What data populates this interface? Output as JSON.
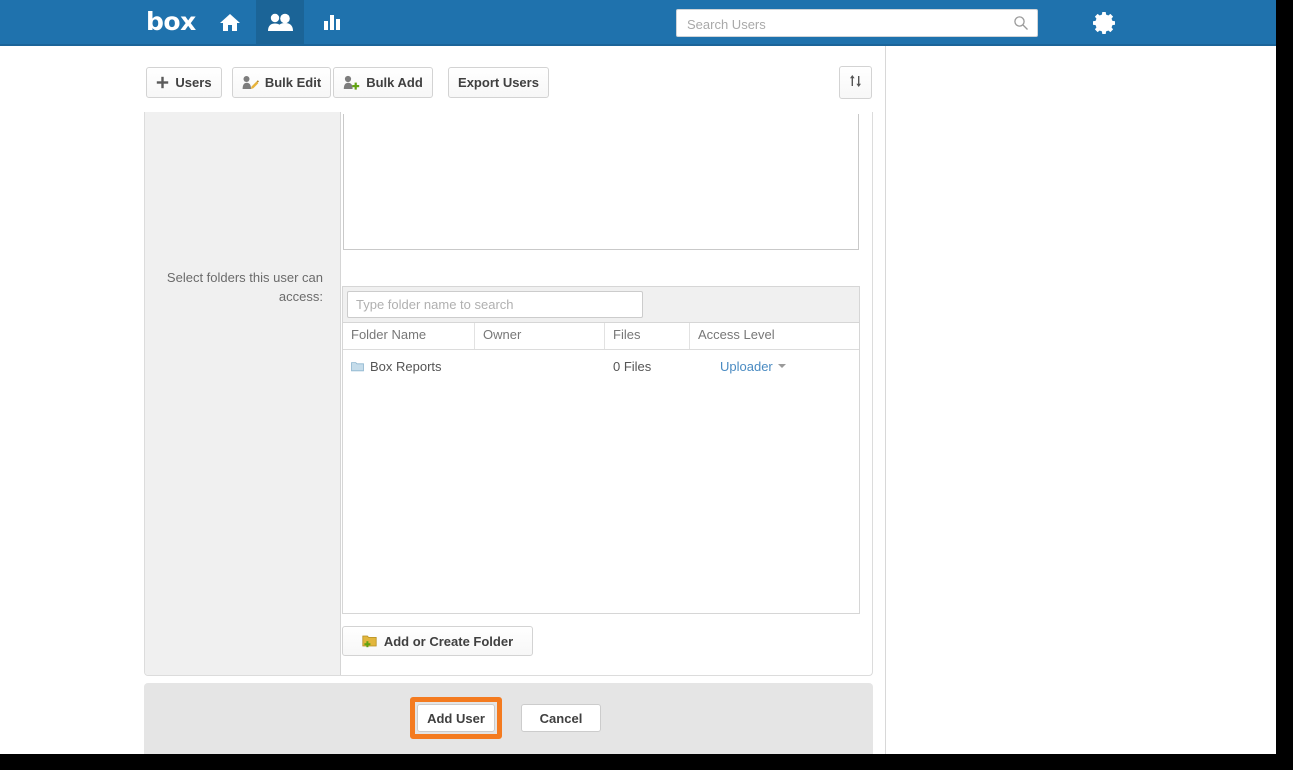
{
  "header": {
    "brand": "box",
    "nav": [
      {
        "name": "home-icon",
        "label": "Home",
        "active": false
      },
      {
        "name": "users-icon",
        "label": "Users",
        "active": true
      },
      {
        "name": "reports-icon",
        "label": "Reports",
        "active": false
      }
    ],
    "search": {
      "placeholder": "Search Users",
      "value": "",
      "icon": "search-icon"
    },
    "settings_icon": "gear-icon",
    "background_color": "#1f72ad"
  },
  "toolbar": {
    "users_label": "Users",
    "bulk_edit_label": "Bulk Edit",
    "bulk_add_label": "Bulk Add",
    "export_users_label": "Export Users",
    "sort_icon": "sort-arrows-icon"
  },
  "form": {
    "access_label": "Select folders this user can access:",
    "folder_search": {
      "placeholder": "Type folder name to search",
      "value": ""
    },
    "table": {
      "columns": [
        "Folder Name",
        "Owner",
        "Files",
        "Access Level"
      ],
      "rows": [
        {
          "folder_name": "Box Reports",
          "owner": "",
          "files": "0 Files",
          "access_level": "Uploader",
          "icon": "folder-icon"
        }
      ]
    },
    "add_folder_label": "Add or Create Folder"
  },
  "footer": {
    "add_user_label": "Add User",
    "cancel_label": "Cancel",
    "highlight_color": "#f47b20"
  }
}
